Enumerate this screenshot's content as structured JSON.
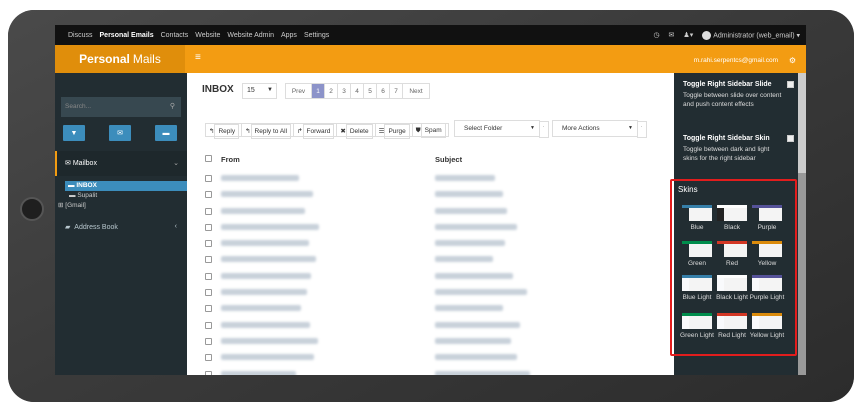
{
  "topnav": {
    "links": [
      "Discuss",
      "Personal Emails",
      "Contacts",
      "Website",
      "Website Admin",
      "Apps",
      "Settings"
    ],
    "active_index": 1,
    "user": "Administrator (web_email)"
  },
  "header": {
    "brand_bold": "Personal",
    "brand_rest": "Mails",
    "email": "m.rahi.serpentcs@gmail.com"
  },
  "sidebar": {
    "search_placeholder": "Search...",
    "mailbox_label": "Mailbox",
    "tree": [
      "INBOX",
      "Supalit",
      "[Gmail]"
    ],
    "address_book": "Address Book"
  },
  "main": {
    "title": "INBOX",
    "per_page": "15",
    "pager": [
      "Prev",
      "1",
      "2",
      "3",
      "4",
      "5",
      "6",
      "7",
      "Next"
    ],
    "current_page": "1",
    "toolbar": [
      "Reply",
      "Reply to All",
      "Forward",
      "Delete",
      "Purge",
      "Spam"
    ],
    "select_folder": "Select Folder",
    "more_actions": "More Actions",
    "col_from": "From",
    "col_subject": "Subject",
    "row_count_visible": 14
  },
  "right_panel": {
    "opt1_title": "Toggle Right Sidebar Slide",
    "opt1_desc": "Toggle between slide over content and push content effects",
    "opt2_title": "Toggle Right Sidebar Skin",
    "opt2_desc": "Toggle between dark and light skins for the right sidebar",
    "skins_title": "Skins",
    "skins": [
      {
        "label": "Blue",
        "bar": "#367fa9",
        "side": "#222d32"
      },
      {
        "label": "Black",
        "bar": "#fefefe",
        "side": "#222222"
      },
      {
        "label": "Purple",
        "bar": "#555299",
        "side": "#222d32"
      },
      {
        "label": "Green",
        "bar": "#008d4c",
        "side": "#222d32"
      },
      {
        "label": "Red",
        "bar": "#d33724",
        "side": "#222d32"
      },
      {
        "label": "Yellow",
        "bar": "#db8b0b",
        "side": "#222d32"
      },
      {
        "label": "Blue Light",
        "bar": "#367fa9",
        "side": "#f9fafc"
      },
      {
        "label": "Black Light",
        "bar": "#fefefe",
        "side": "#f9fafc"
      },
      {
        "label": "Purple Light",
        "bar": "#555299",
        "side": "#f9fafc"
      },
      {
        "label": "Green Light",
        "bar": "#008d4c",
        "side": "#f9fafc"
      },
      {
        "label": "Red Light",
        "bar": "#d33724",
        "side": "#f9fafc"
      },
      {
        "label": "Yellow Light",
        "bar": "#db8b0b",
        "side": "#f9fafc"
      }
    ]
  },
  "colors": {
    "accent": "#f39c12",
    "highlight_box": "#e21d1d",
    "sidebar": "#222d32"
  }
}
